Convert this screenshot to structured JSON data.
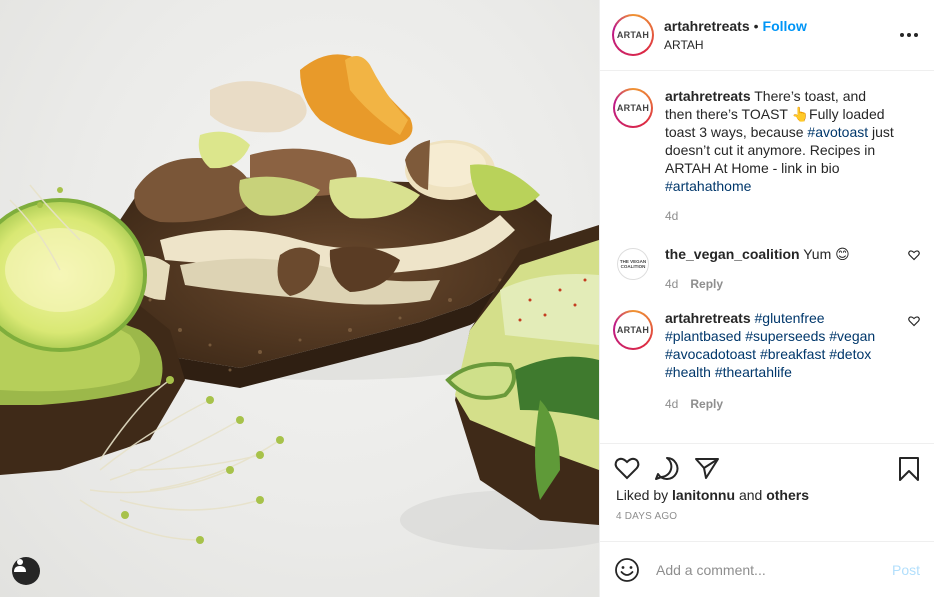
{
  "post": {
    "image_alt": "Loaded toast with mushrooms, leeks, avocado, cucumber and sprouts"
  },
  "header": {
    "avatar_text": "ARTAH",
    "username": "artahretreats",
    "separator": "•",
    "follow_label": "Follow",
    "location": "ARTAH"
  },
  "caption": {
    "avatar_text": "ARTAH",
    "username": "artahretreats",
    "text_1": "There’s toast, and then there’s TOAST 👆Fully loaded toast 3 ways, because",
    "tag_1": "#avotoast",
    "text_2": "just doesn’t cut it anymore. Recipes in ARTAH At Home - link in bio",
    "tag_2": "#artahathome",
    "time": "4d"
  },
  "comments": [
    {
      "avatar_text": "THE VEGAN COALITION",
      "username": "the_vegan_coalition",
      "text": "Yum 😊",
      "time": "4d",
      "reply_label": "Reply"
    },
    {
      "avatar_text": "ARTAH",
      "username": "artahretreats",
      "tags": [
        "#glutenfree",
        "#plantbased",
        "#superseeds",
        "#vegan",
        "#avocadotoast",
        "#breakfast",
        "#detox",
        "#health",
        "#theartahlife"
      ],
      "time": "4d",
      "reply_label": "Reply"
    }
  ],
  "likes": {
    "prefix": "Liked by",
    "user": "lanitonnu",
    "and": "and",
    "others": "others"
  },
  "timestamp": "4 DAYS AGO",
  "add_comment": {
    "placeholder": "Add a comment...",
    "post_label": "Post"
  },
  "icons": [
    "user-tag-icon",
    "more-options-icon",
    "heart-icon",
    "comment-icon",
    "share-icon",
    "save-icon",
    "emoji-icon"
  ]
}
